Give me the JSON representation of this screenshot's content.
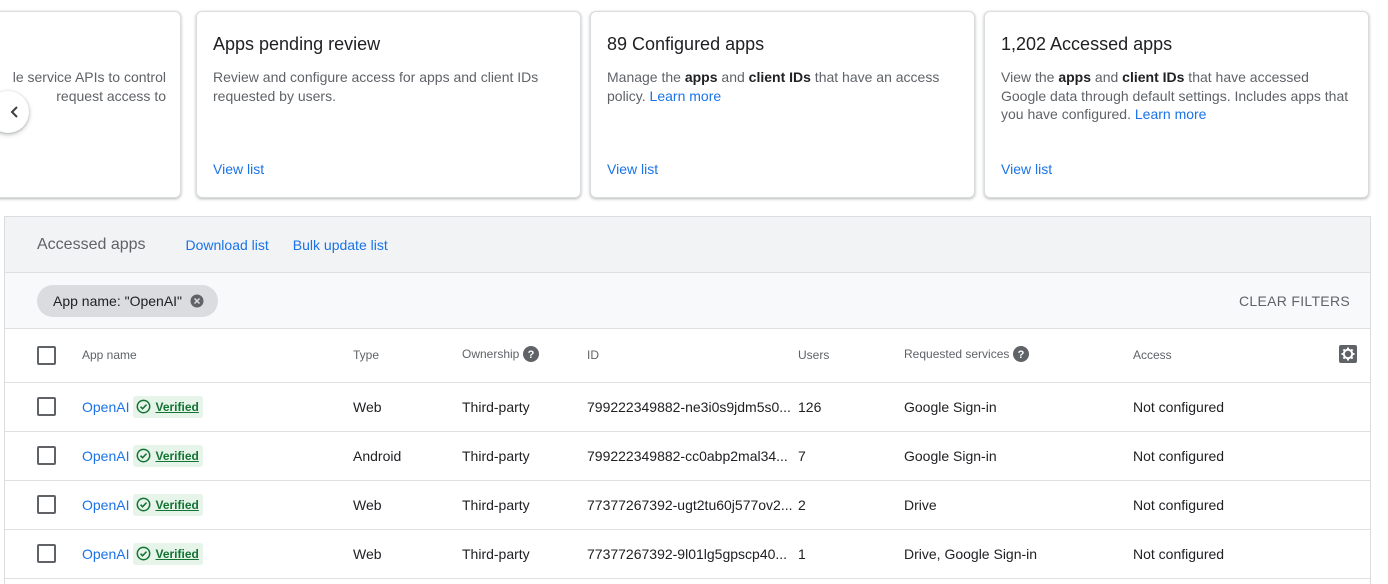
{
  "cards": {
    "partial": {
      "line1": "le service APIs to control",
      "line2": "request access to"
    },
    "pending": {
      "title": "Apps pending review",
      "desc": "Review and configure access for apps and client IDs requested by users.",
      "view": "View list"
    },
    "configured": {
      "title": "89 Configured apps",
      "desc_1": "Manage the ",
      "desc_b1": "apps",
      "desc_2": " and ",
      "desc_b2": "client IDs",
      "desc_3": " that have an access policy. ",
      "learn": "Learn more",
      "view": "View list"
    },
    "accessed": {
      "title": "1,202 Accessed apps",
      "desc_1": "View the ",
      "desc_b1": "apps",
      "desc_2": " and ",
      "desc_b2": "client IDs",
      "desc_3": " that have accessed Google data through default settings. Includes apps that you have configured. ",
      "learn": "Learn more",
      "view": "View list"
    }
  },
  "panel": {
    "title": "Accessed apps",
    "download": "Download list",
    "bulk": "Bulk update list",
    "filter_chip": "App name: \"OpenAI\"",
    "clear_filters": "CLEAR FILTERS"
  },
  "table": {
    "headers": {
      "app_name": "App name",
      "type": "Type",
      "ownership": "Ownership",
      "id": "ID",
      "users": "Users",
      "requested": "Requested services",
      "access": "Access"
    },
    "verified_label": "Verified",
    "rows": [
      {
        "name": "OpenAI",
        "type": "Web",
        "ownership": "Third-party",
        "id": "799222349882-ne3i0s9jdm5s0...",
        "users": "126",
        "services": "Google Sign-in",
        "access": "Not configured"
      },
      {
        "name": "OpenAI",
        "type": "Android",
        "ownership": "Third-party",
        "id": "799222349882-cc0abp2mal34...",
        "users": "7",
        "services": "Google Sign-in",
        "access": "Not configured"
      },
      {
        "name": "OpenAI",
        "type": "Web",
        "ownership": "Third-party",
        "id": "77377267392-ugt2tu60j577ov2...",
        "users": "2",
        "services": "Drive",
        "access": "Not configured"
      },
      {
        "name": "OpenAI",
        "type": "Web",
        "ownership": "Third-party",
        "id": "77377267392-9l01lg5gpscp40...",
        "users": "1",
        "services": "Drive, Google Sign-in",
        "access": "Not configured"
      }
    ]
  },
  "colors": {
    "link": "#1a73e8",
    "verified_bg": "#e6f4ea",
    "verified_fg": "#137333"
  }
}
